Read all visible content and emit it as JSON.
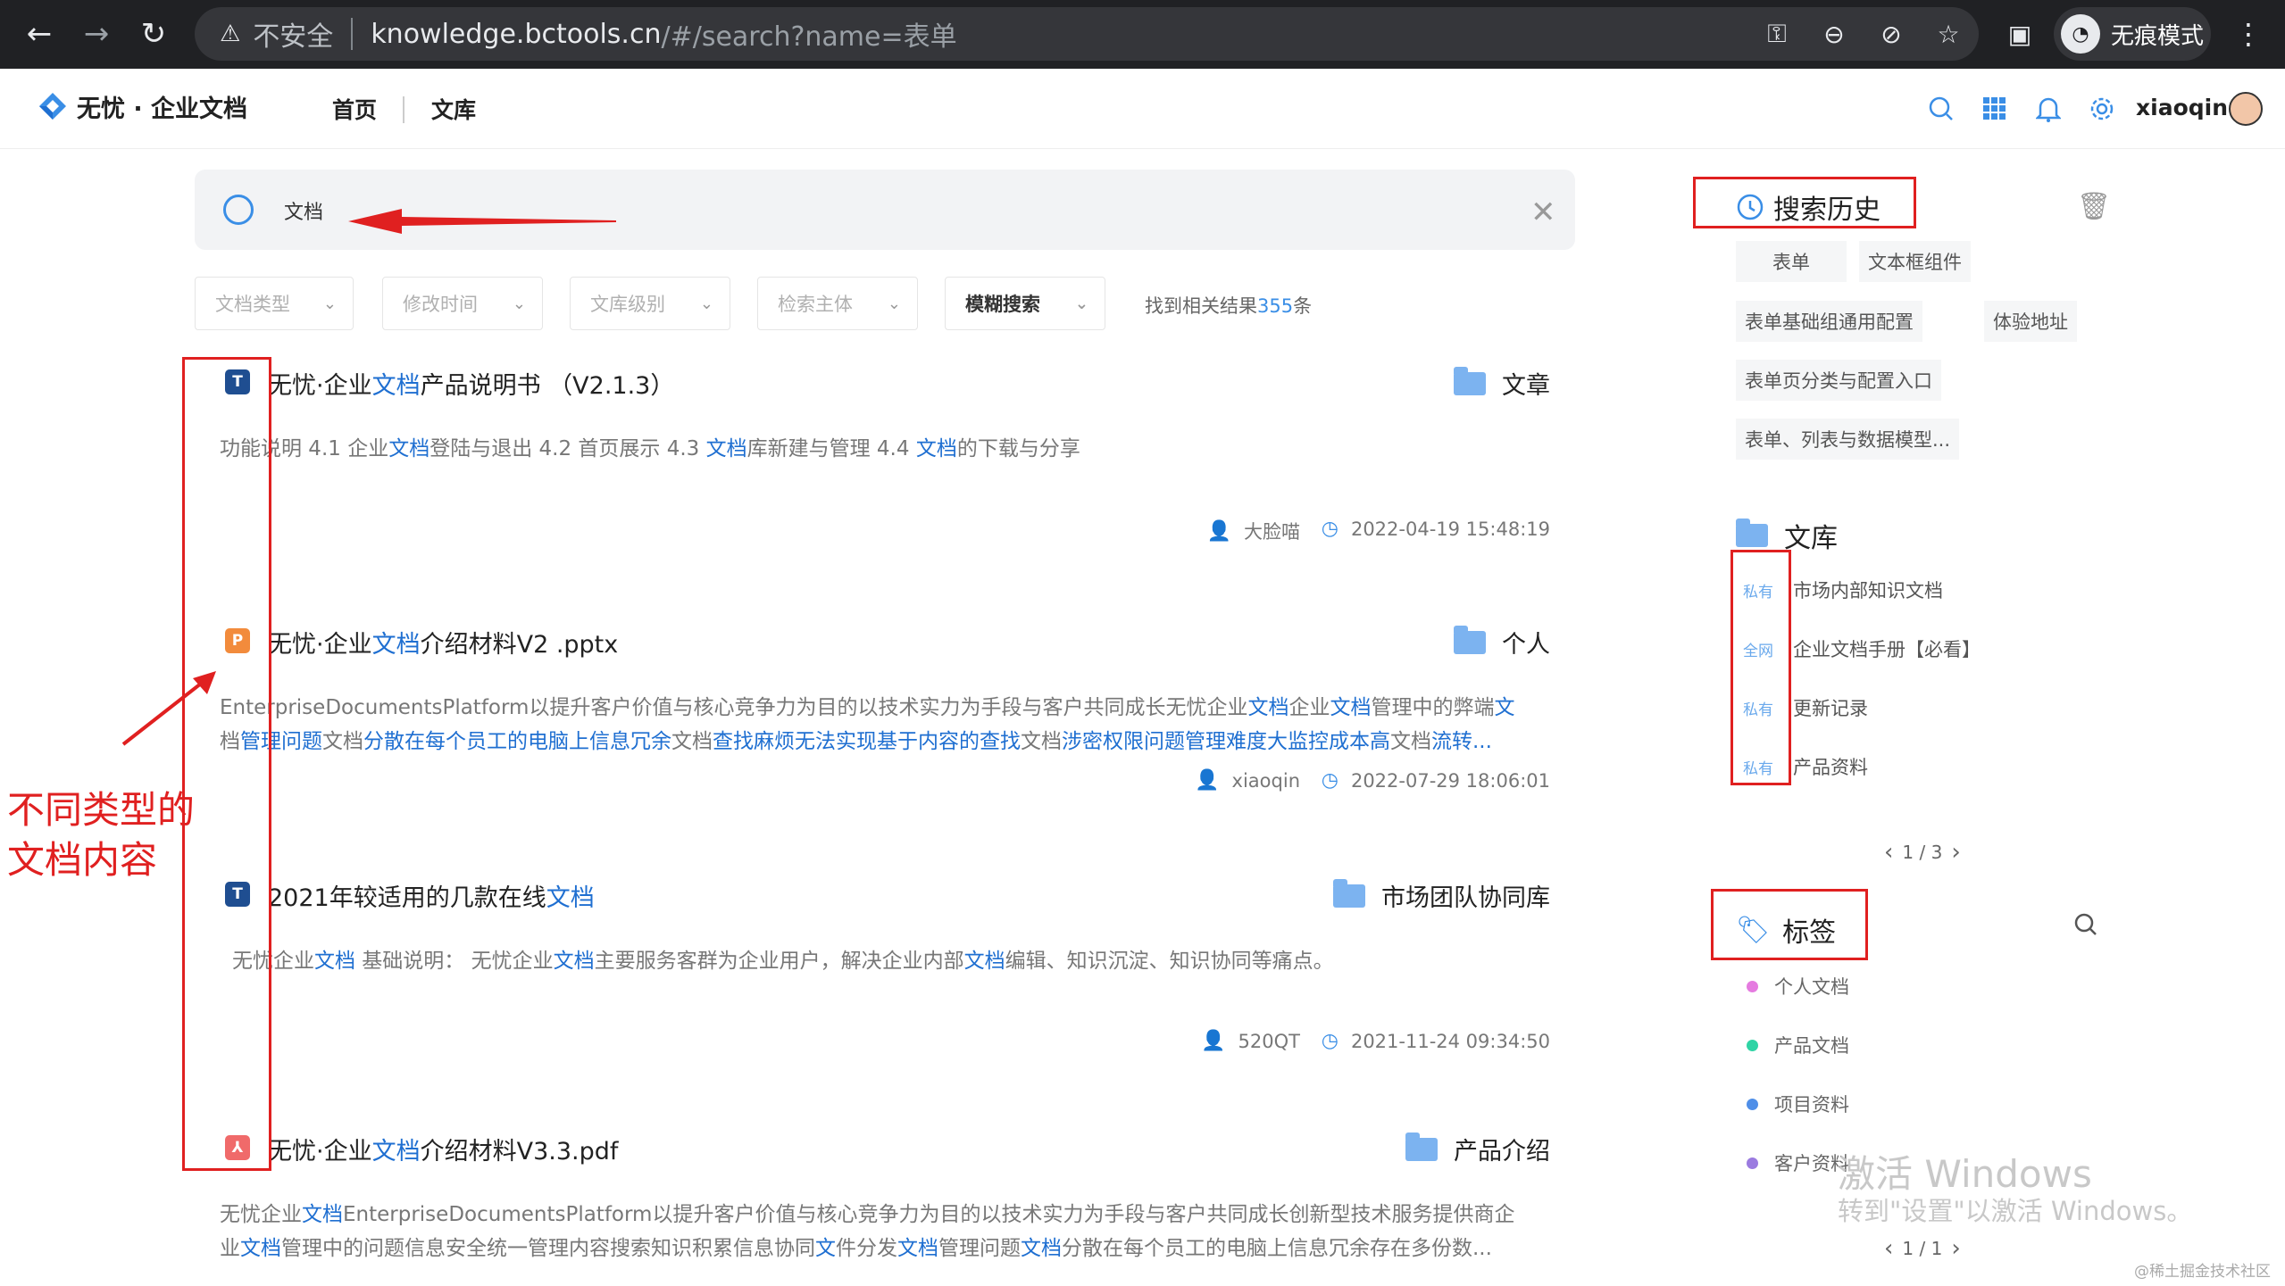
{
  "browser": {
    "insecure_label": "不安全",
    "url_host": "knowledge.bctools.cn",
    "url_path": "/#/search?name=表单",
    "incognito_label": "无痕模式"
  },
  "app": {
    "brand": "无忧 · 企业文档",
    "nav": [
      "首页",
      "文库"
    ],
    "username": "xiaoqin"
  },
  "search": {
    "query": "文档"
  },
  "filters": [
    "文档类型",
    "修改时间",
    "文库级别",
    "检索主体",
    "模糊搜索"
  ],
  "result_summary": {
    "prefix": "找到相关结果",
    "count": "355",
    "suffix": "条"
  },
  "results": [
    {
      "icon_letter": "T",
      "icon_color": "#1f4e91",
      "title_parts": [
        "无忧·企业",
        "文档",
        "产品说明书 （V2.1.3）"
      ],
      "folder": "文章",
      "desc_lines": [
        [
          "功能说明 4.1 企业",
          "文档",
          "登陆与退出 4.2 首页展示 4.3 ",
          "文档",
          "库新建与管理 4.4 ",
          "文档",
          "的下载与分享"
        ]
      ],
      "author": "大脸喵",
      "time": "2022-04-19 15:48:19"
    },
    {
      "icon_letter": "P",
      "icon_color": "#f28b3c",
      "title_parts": [
        "无忧·企业",
        "文档",
        "介绍材料V2 .pptx"
      ],
      "folder": "个人",
      "desc_lines": [
        [
          "EnterpriseDocumentsPlatform以提升客户价值与核心竞争力为目的以技术实力为手段与客户共同成长无忧企业",
          "文档",
          "企业",
          "文档",
          "管理中的弊端",
          "文"
        ],
        [
          "档",
          "管理问题",
          "文档",
          "分散在每个员工的电脑上信息冗余",
          "文档",
          "查找麻烦无法实现基于内容的查找",
          "文档",
          "涉密权限问题管理难度大监控成本高",
          "文档",
          "流转..."
        ]
      ],
      "author": "xiaoqin",
      "time": "2022-07-29 18:06:01"
    },
    {
      "icon_letter": "T",
      "icon_color": "#1f4e91",
      "title_parts": [
        "2021年较适用的几款在线",
        "文档",
        ""
      ],
      "folder": "市场团队协同库",
      "desc_lines": [
        [
          "无忧企业",
          "文档",
          " 基础说明：  无忧企业",
          "文档",
          "主要服务客群为企业用户，解决企业内部",
          "文档",
          "编辑、知识沉淀、知识协同等痛点。"
        ]
      ],
      "author": "520QT",
      "time": "2021-11-24 09:34:50"
    },
    {
      "icon_letter": "⅄",
      "icon_color": "#f06a6a",
      "title_parts": [
        "无忧·企业",
        "文档",
        "介绍材料V3.3.pdf"
      ],
      "folder": "产品介绍",
      "desc_lines": [
        [
          "无忧企业",
          "文档",
          "EnterpriseDocumentsPlatform以提升客户价值与核心竞争力为目的以技术实力为手段与客户共同成长创新型技术服务提供商企"
        ],
        [
          "业",
          "文档",
          "管理中的问题信息安全统一管理内容搜索知识积累信息协同",
          "文",
          "件分发",
          "文档",
          "管理问题",
          "文档",
          "分散在每个员工的电脑上信息冗余存在多份数..."
        ]
      ],
      "author": "",
      "time": ""
    }
  ],
  "history": {
    "title": "搜索历史",
    "items": [
      "表单",
      "文本框组件",
      "表单基础组通用配置",
      "体验地址",
      "表单页分类与配置入口",
      "表单、列表与数据模型..."
    ]
  },
  "library": {
    "title": "文库",
    "items": [
      {
        "tag": "私有",
        "name": "市场内部知识文档"
      },
      {
        "tag": "全网",
        "name": "企业文档手册【必看】"
      },
      {
        "tag": "私有",
        "name": "更新记录"
      },
      {
        "tag": "私有",
        "name": "产品资料"
      }
    ],
    "pager": "1 / 3"
  },
  "tags": {
    "title": "标签",
    "items": [
      {
        "name": "个人文档",
        "color": "#e57be0"
      },
      {
        "name": "产品文档",
        "color": "#2fd4a5"
      },
      {
        "name": "项目资料",
        "color": "#4f8fe8"
      },
      {
        "name": "客户资料",
        "color": "#9b7be0"
      }
    ],
    "pager": "1 / 1"
  },
  "annotation": {
    "line1": "不同类型的",
    "line2": "文档内容"
  },
  "os_watermark": {
    "line1": "激活 Windows",
    "line2": "转到\"设置\"以激活 Windows。"
  },
  "credit": "@稀土掘金技术社区"
}
